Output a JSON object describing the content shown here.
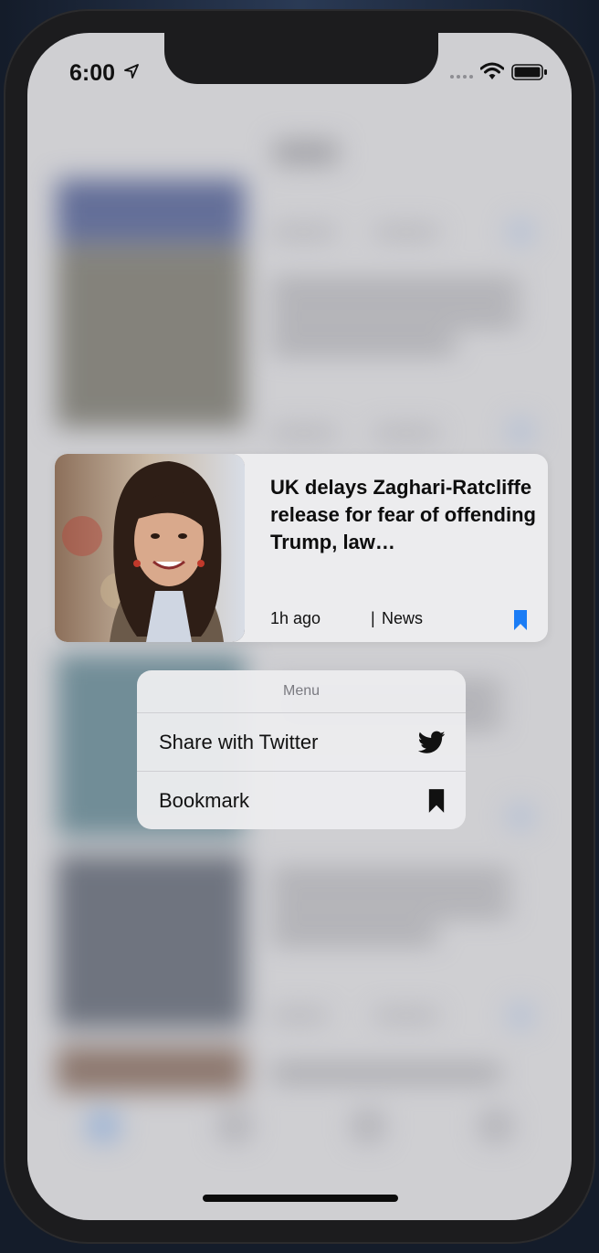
{
  "status_bar": {
    "time": "6:00"
  },
  "preview_card": {
    "title": "UK delays Zaghari-Ratcliffe release for fear of offending Trump, law…",
    "time_ago": "1h ago",
    "separator": "|",
    "category": "News",
    "bookmark_color": "#1a7cf5"
  },
  "context_menu": {
    "header": "Menu",
    "items": [
      {
        "label": "Share with Twitter",
        "icon": "twitter-icon"
      },
      {
        "label": "Bookmark",
        "icon": "bookmark-icon"
      }
    ]
  }
}
